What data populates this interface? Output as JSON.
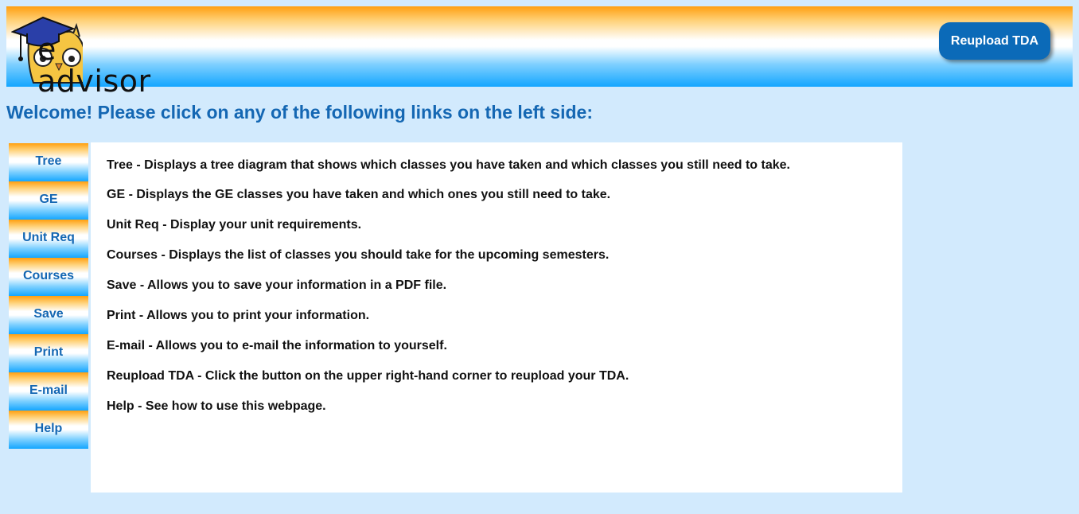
{
  "header": {
    "logo_text": "e advisor",
    "logo_icon": "owl-graduation-cap-icon",
    "reupload_label": "Reupload TDA"
  },
  "welcome": "Welcome! Please click on any of the following links on the left side:",
  "nav": {
    "items": [
      {
        "label": "Tree"
      },
      {
        "label": "GE"
      },
      {
        "label": "Unit Req"
      },
      {
        "label": "Courses"
      },
      {
        "label": "Save"
      },
      {
        "label": "Print"
      },
      {
        "label": "E-mail"
      },
      {
        "label": "Help"
      }
    ]
  },
  "descriptions": [
    "Tree - Displays a tree diagram that shows which classes you have taken and which classes you still need to take.",
    "GE - Displays the GE classes you have taken and which ones you still need to take.",
    "Unit Req - Display your unit requirements.",
    "Courses - Displays the list of classes you should take for the upcoming semesters.",
    "Save - Allows you to save your information in a PDF file.",
    "Print - Allows you to print your information.",
    "E-mail - Allows you to e-mail the information to yourself.",
    "Reupload TDA - Click the button on the upper right-hand corner to reupload your TDA.",
    "Help - See how to use this webpage."
  ],
  "colors": {
    "background": "#d2eafd",
    "accent_blue": "#1467b3",
    "button_blue": "#0b6ab8",
    "gradient_orange": "#ff9f10",
    "gradient_blue": "#14a6ff"
  }
}
